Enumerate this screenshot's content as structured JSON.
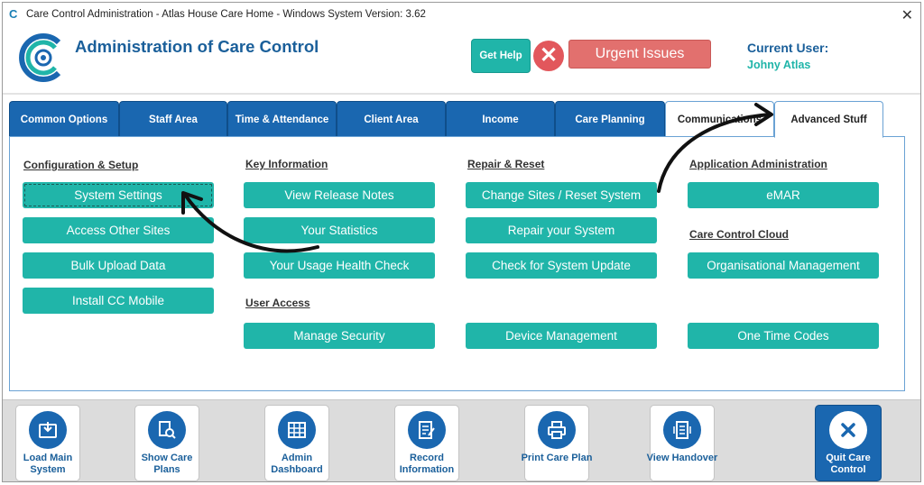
{
  "window": {
    "title": "Care Control Administration - Atlas House Care Home - Windows System Version: 3.62",
    "close_glyph": "✕"
  },
  "header": {
    "app_title": "Administration of Care Control",
    "help_label": "Get Help",
    "close_glyph": "✕",
    "urgent_label": "Urgent Issues",
    "current_user_label": "Current User:",
    "current_user_name": "Johny Atlas"
  },
  "tabs": [
    {
      "label": "Common Options",
      "state": "normal"
    },
    {
      "label": "Staff Area",
      "state": "normal"
    },
    {
      "label": "Time & Attendance",
      "state": "normal"
    },
    {
      "label": "Client Area",
      "state": "normal"
    },
    {
      "label": "Income",
      "state": "normal"
    },
    {
      "label": "Care Planning",
      "state": "normal"
    },
    {
      "label": "Communications",
      "state": "light"
    },
    {
      "label": "Advanced Stuff",
      "state": "active"
    }
  ],
  "sections": {
    "config": {
      "heading": "Configuration & Setup",
      "buttons": [
        "System Settings",
        "Access Other Sites",
        "Bulk Upload Data",
        "Install CC Mobile"
      ]
    },
    "key_info": {
      "heading": "Key Information",
      "buttons": [
        "View Release Notes",
        "Your Statistics",
        "Your Usage Health Check"
      ]
    },
    "user_access": {
      "heading": "User Access",
      "buttons": [
        "Manage Security"
      ]
    },
    "repair": {
      "heading": "Repair & Reset",
      "buttons": [
        "Change Sites / Reset System",
        "Repair your System",
        "Check for System Update",
        "Device Management"
      ]
    },
    "app_admin": {
      "heading": "Application Administration",
      "buttons": [
        "eMAR"
      ]
    },
    "cloud": {
      "heading": "Care Control Cloud",
      "buttons": [
        "Organisational Management",
        "One Time Codes"
      ]
    }
  },
  "bottom_buttons": [
    {
      "label": "Load Main System",
      "icon": "download-box-icon"
    },
    {
      "label": "Show Care Plans",
      "icon": "documents-search-icon"
    },
    {
      "label": "Admin Dashboard",
      "icon": "dashboard-grid-icon"
    },
    {
      "label": "Record Information",
      "icon": "edit-document-icon"
    },
    {
      "label": "Print Care Plan",
      "icon": "printer-icon"
    },
    {
      "label": "View Handover",
      "icon": "handover-list-icon"
    },
    {
      "label": "Quit Care Control",
      "icon": "close-circle-icon"
    }
  ],
  "colors": {
    "teal": "#20b5a9",
    "blue": "#1a67b0",
    "title_blue": "#1a5f9a",
    "urgent_red": "#e2706e",
    "close_red": "#e2575c"
  }
}
